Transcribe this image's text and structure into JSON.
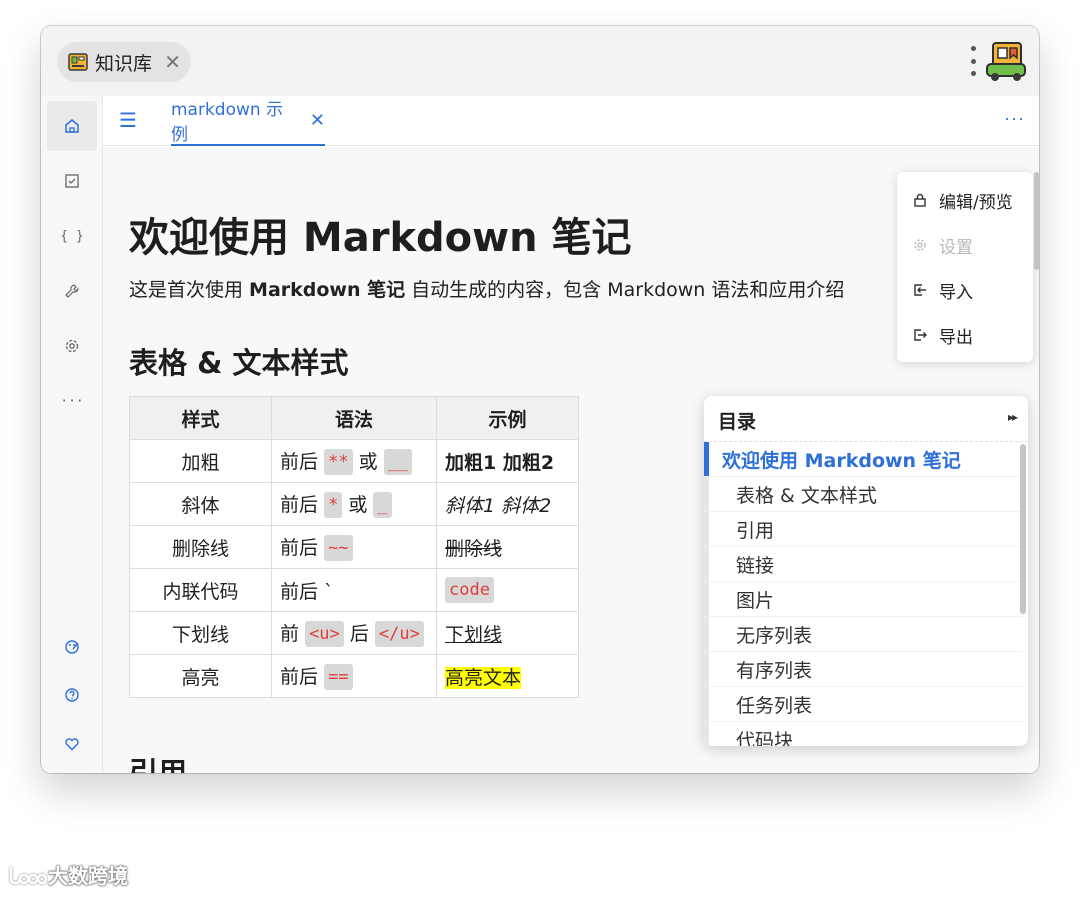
{
  "titlebar": {
    "app_tab_label": "知识库",
    "close_glyph": "✕"
  },
  "sidebar": {
    "items": [
      {
        "name": "home-icon"
      },
      {
        "name": "checkbox-icon"
      },
      {
        "name": "code-braces-icon",
        "text": "{ }"
      },
      {
        "name": "wrench-icon"
      },
      {
        "name": "settings-icon"
      },
      {
        "name": "more-icon",
        "text": "···"
      },
      {
        "name": "theme-icon"
      },
      {
        "name": "help-icon"
      },
      {
        "name": "heart-icon"
      }
    ]
  },
  "tabbar": {
    "doc_tab_label": "markdown 示例",
    "close_glyph": "✕",
    "more_glyph": "···",
    "hamburger": "☰"
  },
  "doc": {
    "title": "欢迎使用 Markdown 笔记",
    "intro_before": "这是首次使用 ",
    "intro_bold": "Markdown 笔记",
    "intro_after": " 自动生成的内容，包含 Markdown 语法和应用介绍",
    "section_title": "表格 & 文本样式",
    "next_section_title": "引用",
    "table": {
      "headers": [
        "样式",
        "语法",
        "示例"
      ],
      "rows": [
        {
          "style": "加粗",
          "prefix": "前后",
          "code1": "**",
          "or": "或",
          "code2": "__",
          "example": "加粗1 加粗2"
        },
        {
          "style": "斜体",
          "prefix": "前后",
          "code1": "*",
          "or": "或",
          "code2": "_",
          "example": "斜体1 斜体2"
        },
        {
          "style": "删除线",
          "prefix": "前后",
          "code1": "~~",
          "example": "删除线"
        },
        {
          "style": "内联代码",
          "prefix": "前后 `",
          "example": "code"
        },
        {
          "style": "下划线",
          "prefix": "前",
          "code1": "<u>",
          "mid": "后",
          "code2": "</u>",
          "example": "下划线"
        },
        {
          "style": "高亮",
          "prefix": "前后",
          "code1": "==",
          "example": "高亮文本"
        }
      ]
    }
  },
  "menu": {
    "items": [
      {
        "label": "编辑/预览",
        "icon": "lock-icon",
        "disabled": false
      },
      {
        "label": "设置",
        "icon": "gear-icon",
        "disabled": true
      },
      {
        "label": "导入",
        "icon": "import-icon",
        "disabled": false
      },
      {
        "label": "导出",
        "icon": "export-icon",
        "disabled": false
      }
    ]
  },
  "toc": {
    "title": "目录",
    "collapse_glyph": "▸▸",
    "items": [
      {
        "label": "欢迎使用 Markdown 笔记",
        "active": true
      },
      {
        "label": "表格 & 文本样式"
      },
      {
        "label": "引用"
      },
      {
        "label": "链接"
      },
      {
        "label": "图片"
      },
      {
        "label": "无序列表"
      },
      {
        "label": "有序列表"
      },
      {
        "label": "任务列表"
      },
      {
        "label": "代码块"
      }
    ]
  },
  "watermark": "大数跨境",
  "colors": {
    "accent": "#2f6fd8",
    "code_red": "#e03e3e",
    "highlight": "#ffff00"
  }
}
